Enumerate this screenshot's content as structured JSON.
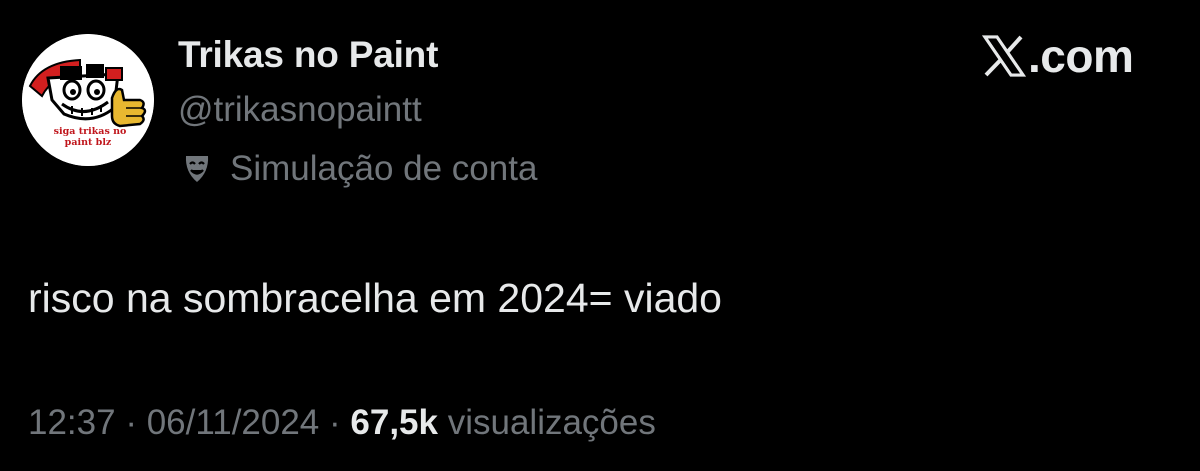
{
  "author": {
    "display_name": "Trikas no Paint",
    "handle": "@trikasnopaintt",
    "avatar_text_line1": "siga trikas no",
    "avatar_text_line2": "paint blz",
    "parody_label": "Simulação de conta",
    "parody_icon": "theater-masks-icon"
  },
  "brand": {
    "logo_icon": "x-logo-icon",
    "suffix": ".com"
  },
  "tweet": {
    "text": "risco na sombracelha em 2024= viado"
  },
  "meta": {
    "time": "12:37",
    "separator": " · ",
    "date": "06/11/2024",
    "views_count": "67,5k",
    "views_label": " visualizações"
  },
  "colors": {
    "background": "#000000",
    "primary_text": "#e7e9ea",
    "secondary_text": "#71767b"
  }
}
